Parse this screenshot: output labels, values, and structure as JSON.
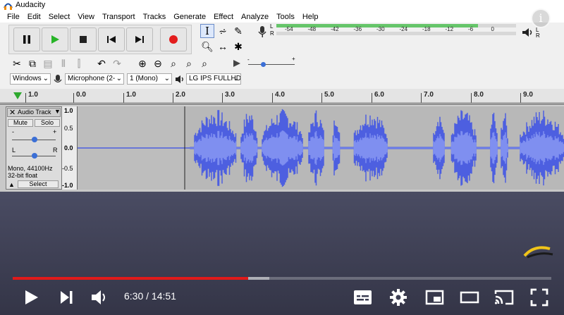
{
  "app": {
    "title": "Audacity",
    "menu": [
      "File",
      "Edit",
      "Select",
      "View",
      "Transport",
      "Tracks",
      "Generate",
      "Effect",
      "Analyze",
      "Tools",
      "Help"
    ]
  },
  "meter": {
    "scale": [
      "-54",
      "-48",
      "-42",
      "-36",
      "-30",
      "-24",
      "-18",
      "-12",
      "-6",
      "0"
    ],
    "left_label": "L",
    "right_label": "R",
    "level": 0.84
  },
  "device": {
    "host": "Windows",
    "input": "Microphone (2-",
    "channels": "1 (Mono)",
    "output": "LG IPS FULLHD"
  },
  "ruler": {
    "ticks": [
      "1.0",
      "0.0",
      "1.0",
      "2.0",
      "3.0",
      "4.0",
      "5.0",
      "6.0",
      "7.0",
      "8.0",
      "9.0"
    ]
  },
  "track": {
    "name": "Audio Track",
    "mute": "Mute",
    "solo": "Solo",
    "gain_minus": "-",
    "gain_plus": "+",
    "pan_left": "L",
    "pan_right": "R",
    "format": "Mono, 44100Hz",
    "bitdepth": "32-bit float",
    "select": "Select",
    "scale": [
      "1.0",
      "0.5",
      "0.0",
      "-0.5",
      "-1.0"
    ]
  },
  "player": {
    "time": "6:30 / 14:51",
    "played_fraction": 0.4376,
    "buffered_fraction": 0.4765,
    "colors": {
      "played": "#e01a1a",
      "wave": "#4d5fe0"
    }
  },
  "icons": [
    "pause-icon",
    "play-icon",
    "stop-icon",
    "skip-start-icon",
    "skip-end-icon",
    "record-icon",
    "mic-icon",
    "speaker-icon",
    "volume-icon",
    "next-icon",
    "subtitles-icon",
    "settings-icon",
    "miniplayer-icon",
    "theater-icon",
    "cast-icon",
    "fullscreen-icon",
    "info-icon"
  ]
}
